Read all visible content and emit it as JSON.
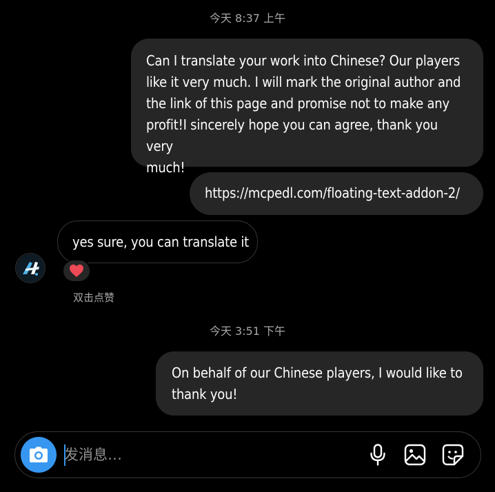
{
  "thread": {
    "timestamp_1": "今天 8:37 上午",
    "msg_1": "Can I translate your work into Chinese? Our players like it very much. I will mark the original author and the link of this page and promise not to make any profit!I sincerely hope you can agree, thank you very much!",
    "msg_1_lines": [
      "Can I translate your work into Chinese? Our players",
      "like it very much. I will mark the original author and",
      "the link of this page and promise not to make any",
      "profit!I sincerely hope you can agree, thank you very",
      "much!"
    ],
    "msg_2": "https://mcpedl.com/floating-text-addon-2/",
    "reply": "yes sure, you can translate it",
    "reaction": "❤️",
    "double_tap_hint": "双击点赞",
    "timestamp_2": "今天 3:51 下午",
    "msg_3_lines": [
      "On behalf of our Chinese players, I would like to",
      "thank you!"
    ]
  },
  "composer": {
    "placeholder": "发消息…",
    "camera_icon": "camera-icon",
    "mic_icon": "microphone-icon",
    "gallery_icon": "image-icon",
    "sticker_icon": "sticker-icon"
  },
  "colors": {
    "background": "#000000",
    "outgoing_bubble": "#262626",
    "incoming_border": "#363636",
    "accent": "#3797f0",
    "secondary_text": "#a8a8a8",
    "heart": "#ed4956"
  }
}
